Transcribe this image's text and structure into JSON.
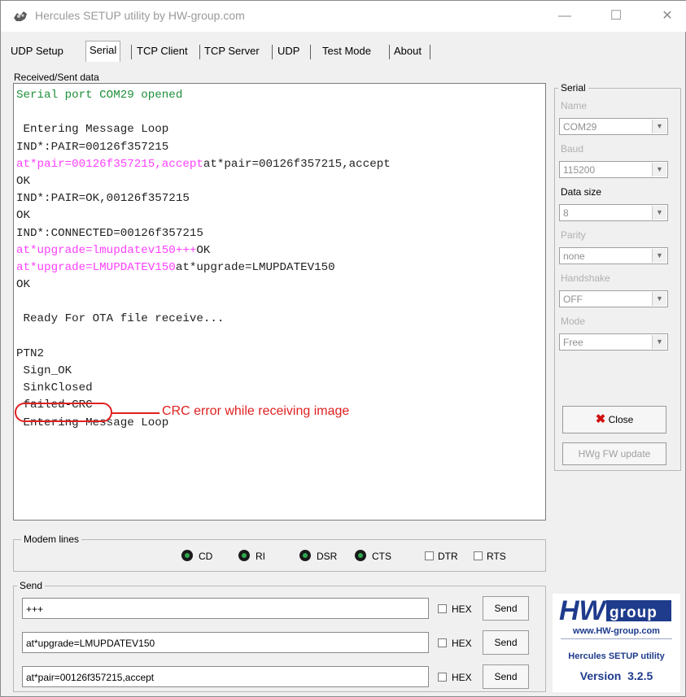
{
  "window": {
    "title": "Hercules SETUP utility by HW-group.com",
    "controls": {
      "minimize": "—",
      "maximize": "☐",
      "close": "✕"
    }
  },
  "tabs": [
    {
      "label": "UDP Setup"
    },
    {
      "label": "Serial"
    },
    {
      "label": "TCP Client"
    },
    {
      "label": "TCP Server"
    },
    {
      "label": "UDP"
    },
    {
      "label": "Test Mode"
    },
    {
      "label": "About"
    }
  ],
  "received": {
    "label": "Received/Sent data",
    "lines": [
      [
        {
          "t": "Serial port COM29 opened",
          "c": "green"
        }
      ],
      [
        {
          "t": "",
          "c": "black"
        }
      ],
      [
        {
          "t": " Entering Message Loop",
          "c": "black"
        }
      ],
      [
        {
          "t": "IND*:PAIR=00126f357215",
          "c": "black"
        }
      ],
      [
        {
          "t": "at*pair=00126f357215,accept",
          "c": "magenta"
        },
        {
          "t": "at*pair=00126f357215,accept",
          "c": "black"
        }
      ],
      [
        {
          "t": "OK",
          "c": "black"
        }
      ],
      [
        {
          "t": "IND*:PAIR=OK,00126f357215",
          "c": "black"
        }
      ],
      [
        {
          "t": "OK",
          "c": "black"
        }
      ],
      [
        {
          "t": "IND*:CONNECTED=00126f357215",
          "c": "black"
        }
      ],
      [
        {
          "t": "at*upgrade=lmupdatev150+++",
          "c": "magenta"
        },
        {
          "t": "OK",
          "c": "black"
        }
      ],
      [
        {
          "t": "at*upgrade=LMUPDATEV150",
          "c": "magenta"
        },
        {
          "t": "at*upgrade=LMUPDATEV150",
          "c": "black"
        }
      ],
      [
        {
          "t": "OK",
          "c": "black"
        }
      ],
      [
        {
          "t": "",
          "c": "black"
        }
      ],
      [
        {
          "t": " Ready For OTA file receive...",
          "c": "black"
        }
      ],
      [
        {
          "t": "",
          "c": "black"
        }
      ],
      [
        {
          "t": "PTN2",
          "c": "black"
        }
      ],
      [
        {
          "t": " Sign_OK",
          "c": "black"
        }
      ],
      [
        {
          "t": " SinkClosed",
          "c": "black"
        }
      ],
      [
        {
          "t": " failed-CRC",
          "c": "black"
        }
      ],
      [
        {
          "t": " Entering Message Loop",
          "c": "black"
        }
      ]
    ],
    "annotation": "CRC error while receiving image"
  },
  "serial": {
    "group_label": "Serial",
    "name_label": "Name",
    "name_value": "COM29",
    "baud_label": "Baud",
    "baud_value": "115200",
    "datasize_label": "Data size",
    "datasize_value": "8",
    "parity_label": "Parity",
    "parity_value": "none",
    "handshake_label": "Handshake",
    "handshake_value": "OFF",
    "mode_label": "Mode",
    "mode_value": "Free",
    "close_button": "Close",
    "fw_update_button": "HWg FW update"
  },
  "modem": {
    "label": "Modem lines",
    "leds": [
      "CD",
      "RI",
      "DSR",
      "CTS"
    ],
    "checks": [
      "DTR",
      "RTS"
    ]
  },
  "send": {
    "label": "Send",
    "rows": [
      {
        "value": "+++",
        "hex_label": "HEX",
        "button": "Send"
      },
      {
        "value": "at*upgrade=LMUPDATEV150",
        "hex_label": "HEX",
        "button": "Send"
      },
      {
        "value": "at*pair=00126f357215,accept",
        "hex_label": "HEX",
        "button": "Send"
      }
    ]
  },
  "logo": {
    "brand": "group",
    "url": "www.HW-group.com",
    "product": "Hercules SETUP utility",
    "version": "Version  3.2.5"
  },
  "colors": {
    "received_text": "#1f8f3a",
    "sent_text": "#ff40ff",
    "annotation": "#e02020",
    "logo_blue": "#1e3b8c"
  }
}
